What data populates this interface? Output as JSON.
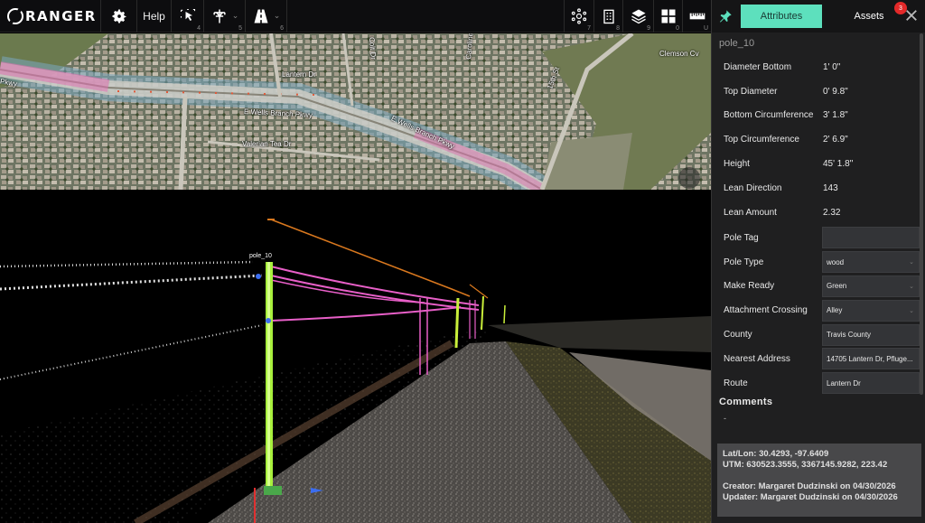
{
  "app": {
    "name": "RANGER"
  },
  "toolbar": {
    "help_label": "Help",
    "hotkeys": {
      "select": "4",
      "pole": "5",
      "road": "6",
      "network": "7",
      "building": "8",
      "layers": "9",
      "grid": "0",
      "measure": "U"
    }
  },
  "map": {
    "labels": {
      "road1": "E Wells Branch Pkwy",
      "road2": "E Wells Branch Pkwy",
      "road3": "Valerian Tea Dr",
      "road4": "Lantern Dr",
      "road5": "15th St",
      "road6": "Clemson Cv",
      "road7": "Pkwy",
      "road8": "Caroline Dr",
      "road9": "Colt Dr"
    }
  },
  "viewer": {
    "pole_label": "pole_10"
  },
  "panel": {
    "tabs": {
      "attributes": "Attributes",
      "assets": "Assets"
    },
    "assets_badge": "3",
    "pole_title": "pole_10",
    "attributes": [
      {
        "label": "Diameter Bottom",
        "value": "1' 0\""
      },
      {
        "label": "Top Diameter",
        "value": "0' 9.8\""
      },
      {
        "label": "Bottom Circumference",
        "value": "3' 1.8\""
      },
      {
        "label": "Top Circumference",
        "value": "2' 6.9\""
      },
      {
        "label": "Height",
        "value": "45' 1.8\""
      },
      {
        "label": "Lean Direction",
        "value": "143"
      },
      {
        "label": "Lean Amount",
        "value": "2.32"
      }
    ],
    "fields": [
      {
        "label": "Pole Tag",
        "value": ""
      },
      {
        "label": "Pole Type",
        "value": "wood"
      },
      {
        "label": "Make Ready",
        "value": "Green"
      },
      {
        "label": "Attachment Crossing",
        "value": "Alley"
      },
      {
        "label": "County",
        "value": "Travis County"
      },
      {
        "label": "Nearest Address",
        "value": "14705 Lantern Dr, Pfluge..."
      },
      {
        "label": "Route",
        "value": "Lantern Dr"
      }
    ],
    "comments_heading": "Comments",
    "comments_value": "-",
    "info": {
      "latlon": "Lat/Lon: 30.4293, -97.6409",
      "utm": "UTM: 630523.3555, 3367145.9282, 223.42",
      "creator": "Creator: Margaret Dudzinski on 04/30/2026",
      "updater": "Updater: Margaret Dudzinski on 04/30/2026"
    }
  },
  "colors": {
    "accent": "#5de0bd",
    "badge": "#e32929",
    "pole": "#a8f03c",
    "wire": "#e85fc8",
    "guy": "#d9781e"
  }
}
